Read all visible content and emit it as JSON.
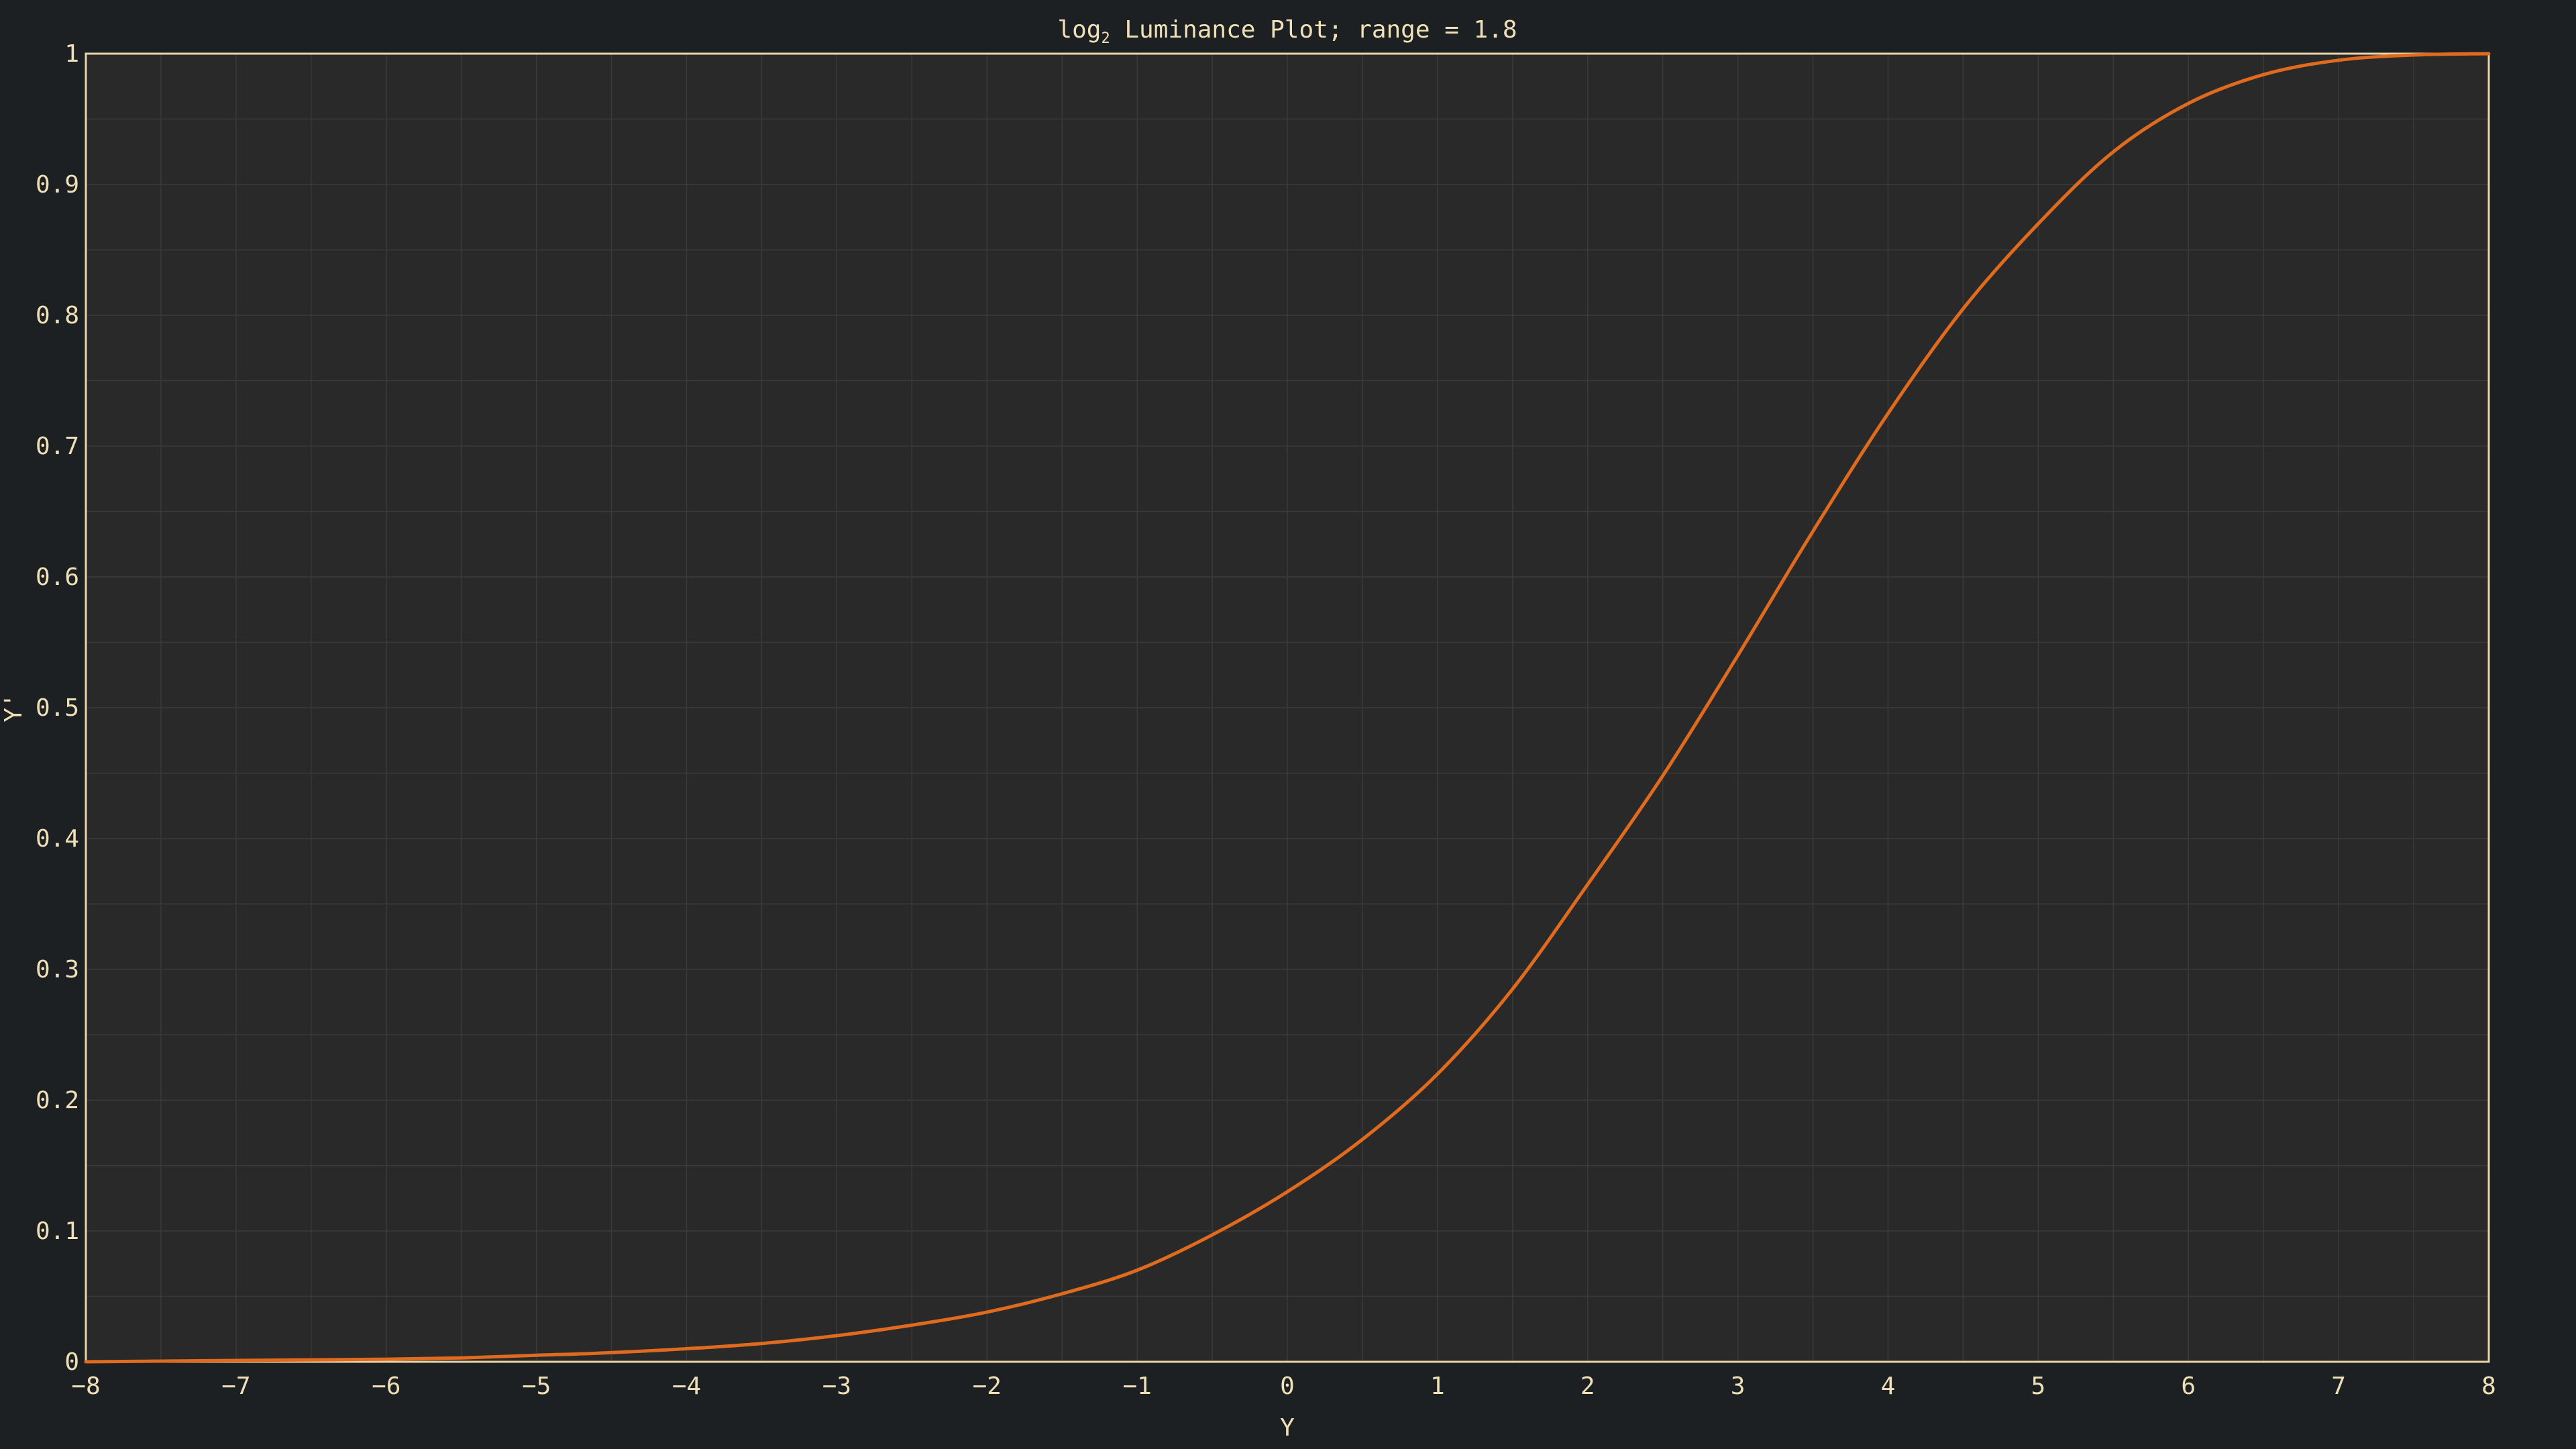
{
  "chart_data": {
    "type": "line",
    "title": {
      "prefix": "log",
      "subscript": "2",
      "rest": " Luminance Plot; range = 1.8"
    },
    "xlabel": "Y",
    "ylabel": "Y'",
    "xlim": [
      -8,
      8
    ],
    "ylim": [
      0,
      1
    ],
    "xticks": [
      -8,
      -7,
      -6,
      -5,
      -4,
      -3,
      -2,
      -1,
      0,
      1,
      2,
      3,
      4,
      5,
      6,
      7,
      8
    ],
    "yticks": [
      0,
      0.1,
      0.2,
      0.3,
      0.4,
      0.5,
      0.6,
      0.7,
      0.8,
      0.9,
      1
    ],
    "ytick_labels": [
      "0",
      "0.1",
      "0.2",
      "0.3",
      "0.4",
      "0.5",
      "0.6",
      "0.7",
      "0.8",
      "0.9",
      "1"
    ],
    "minor_x_step": 0.5,
    "minor_y_step": 0.05,
    "grid": true,
    "colors": {
      "page_background": "#1c2022",
      "plot_background": "#292929",
      "grid": "#3a3a3a",
      "frame": "#e8d4a8",
      "text": "#f0e0b8",
      "line": "#e06a1e"
    },
    "series": [
      {
        "x": [
          -8,
          -7.5,
          -7,
          -6.5,
          -6,
          -5.5,
          -5,
          -4.5,
          -4,
          -3.5,
          -3,
          -2.5,
          -2,
          -1.5,
          -1,
          -0.5,
          0,
          0.5,
          1,
          1.5,
          2,
          2.5,
          3,
          3.5,
          4,
          4.5,
          5,
          5.5,
          6,
          6.5,
          7,
          7.5,
          8
        ],
        "y": [
          0.0,
          0.0005,
          0.001,
          0.0015,
          0.002,
          0.003,
          0.005,
          0.007,
          0.01,
          0.014,
          0.02,
          0.028,
          0.038,
          0.052,
          0.07,
          0.097,
          0.13,
          0.17,
          0.22,
          0.285,
          0.365,
          0.448,
          0.54,
          0.635,
          0.725,
          0.805,
          0.87,
          0.925,
          0.962,
          0.984,
          0.995,
          0.999,
          1.0
        ]
      }
    ]
  }
}
